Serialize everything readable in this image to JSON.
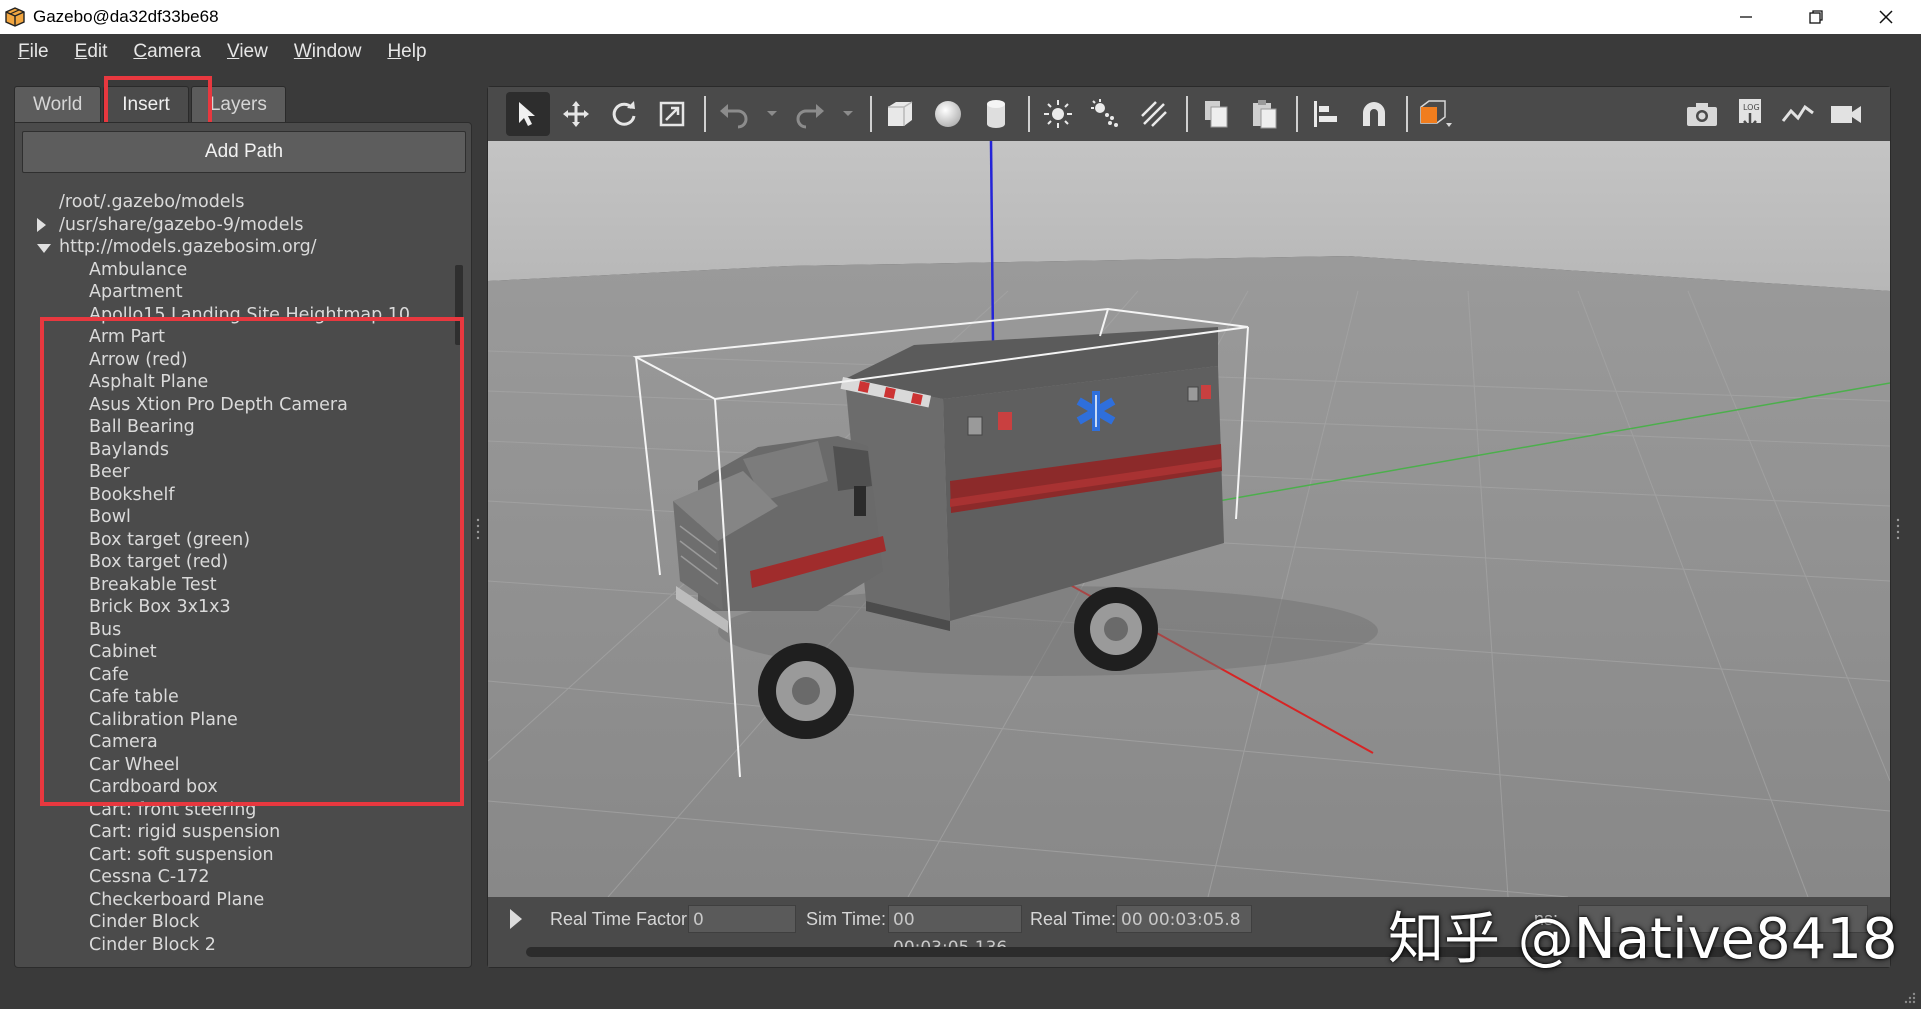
{
  "window": {
    "title": "Gazebo@da32df33be68",
    "controls": [
      "minimize",
      "restore",
      "close"
    ]
  },
  "menu": {
    "items": [
      {
        "label": "File",
        "mnemonic": "F",
        "rest": "ile"
      },
      {
        "label": "Edit",
        "mnemonic": "E",
        "rest": "dit"
      },
      {
        "label": "Camera",
        "mnemonic": "C",
        "rest": "amera"
      },
      {
        "label": "View",
        "mnemonic": "V",
        "rest": "iew"
      },
      {
        "label": "Window",
        "mnemonic": "W",
        "rest": "indow"
      },
      {
        "label": "Help",
        "mnemonic": "H",
        "rest": "elp"
      }
    ]
  },
  "left_panel": {
    "tabs": [
      {
        "label": "World",
        "active": false
      },
      {
        "label": "Insert",
        "active": true
      },
      {
        "label": "Layers",
        "active": false
      }
    ],
    "add_path_label": "Add Path",
    "paths": [
      {
        "label": "/root/.gazebo/models",
        "expanded": null
      },
      {
        "label": "/usr/share/gazebo-9/models",
        "expanded": false
      },
      {
        "label": "http://models.gazebosim.org/",
        "expanded": true
      }
    ],
    "models": [
      "Ambulance",
      "Apartment",
      "Apollo15 Landing Site Heightmap 10...",
      "Arm Part",
      "Arrow (red)",
      "Asphalt Plane",
      "Asus Xtion Pro Depth Camera",
      "Ball Bearing",
      "Baylands",
      "Beer",
      "Bookshelf",
      "Bowl",
      "Box target (green)",
      "Box target (red)",
      "Breakable Test",
      "Brick Box 3x1x3",
      "Bus",
      "Cabinet",
      "Cafe",
      "Cafe table",
      "Calibration Plane",
      "Camera",
      "Car Wheel",
      "Cardboard box",
      "Cart: front steering",
      "Cart: rigid suspension",
      "Cart: soft suspension",
      "Cessna C-172",
      "Checkerboard Plane",
      "Cinder Block",
      "Cinder Block 2"
    ],
    "highlight_color": "#e8383f"
  },
  "toolbar": {
    "left": [
      "select-mode-icon",
      "translate-mode-icon",
      "rotate-mode-icon",
      "scale-mode-icon",
      "undo-icon",
      "undo-history-icon",
      "redo-icon",
      "redo-history-icon",
      "box-shape-icon",
      "sphere-shape-icon",
      "cylinder-shape-icon",
      "point-light-icon",
      "spot-light-icon",
      "directional-light-icon",
      "copy-icon",
      "paste-icon",
      "align-icon",
      "snap-icon",
      "view-angle-icon"
    ],
    "right": [
      "screenshot-icon",
      "log-icon",
      "plot-icon",
      "record-video-icon"
    ],
    "accent": "#f07d1e"
  },
  "status": {
    "real_time_factor_label": "Real Time Factor:",
    "real_time_factor_value": "0",
    "sim_time_label": "Sim Time:",
    "sim_time_value": "00 00:03:05.136",
    "real_time_label": "Real Time:",
    "real_time_value": "00 00:03:05.8",
    "iterations_fragment": "ns:"
  },
  "watermark": "知乎 @Native8418",
  "scene": {
    "model": "Ambulance",
    "axis_colors": {
      "x": "#e02020",
      "y": "#40b040",
      "z": "#2020e0"
    },
    "sky_color": "#bdbdbd",
    "ground_color": "#8e8e8e"
  }
}
